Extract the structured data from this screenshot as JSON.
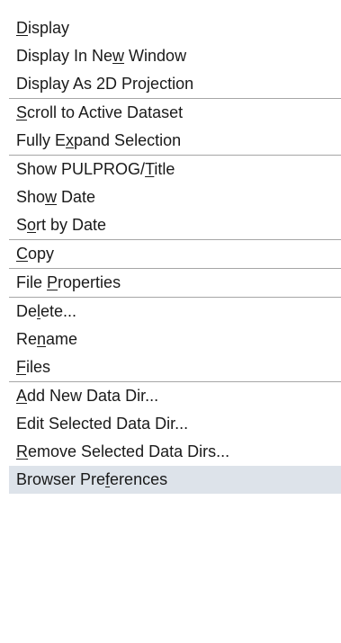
{
  "menu": {
    "groups": [
      {
        "items": [
          {
            "id": "display",
            "pre": "",
            "key": "D",
            "post": "isplay"
          },
          {
            "id": "display-in-new-window",
            "pre": "Display In Ne",
            "key": "w",
            "post": " Window"
          },
          {
            "id": "display-as-2d-projection",
            "pre": "Display As 2D Projection",
            "key": "",
            "post": ""
          }
        ]
      },
      {
        "items": [
          {
            "id": "scroll-to-active-dataset",
            "pre": "",
            "key": "S",
            "post": "croll to Active Dataset"
          },
          {
            "id": "fully-expand-selection",
            "pre": "Fully E",
            "key": "x",
            "post": "pand Selection"
          }
        ]
      },
      {
        "items": [
          {
            "id": "show-pulprog-title",
            "pre": "Show PULPROG/",
            "key": "T",
            "post": "itle"
          },
          {
            "id": "show-date",
            "pre": "Sho",
            "key": "w",
            "post": " Date"
          },
          {
            "id": "sort-by-date",
            "pre": "S",
            "key": "o",
            "post": "rt by Date"
          }
        ]
      },
      {
        "items": [
          {
            "id": "copy",
            "pre": "",
            "key": "C",
            "post": "opy"
          }
        ]
      },
      {
        "items": [
          {
            "id": "file-properties",
            "pre": "File ",
            "key": "P",
            "post": "roperties"
          }
        ]
      },
      {
        "items": [
          {
            "id": "delete",
            "pre": "De",
            "key": "l",
            "post": "ete..."
          },
          {
            "id": "rename",
            "pre": "Re",
            "key": "n",
            "post": "ame"
          },
          {
            "id": "files",
            "pre": "",
            "key": "F",
            "post": "iles"
          }
        ]
      },
      {
        "items": [
          {
            "id": "add-new-data-dir",
            "pre": "",
            "key": "A",
            "post": "dd New Data Dir..."
          },
          {
            "id": "edit-selected-data-dir",
            "pre": "Edit Selected Data Dir...",
            "key": "",
            "post": ""
          },
          {
            "id": "remove-selected-data-dirs",
            "pre": "",
            "key": "R",
            "post": "emove Selected Data Dirs..."
          },
          {
            "id": "browser-preferences",
            "pre": "Browser Pre",
            "key": "f",
            "post": "erences",
            "highlighted": true
          }
        ]
      }
    ],
    "colors": {
      "text": "#1a1a1a",
      "separator": "#a6a6a6",
      "highlight": "#dde3ea",
      "background": "#ffffff"
    }
  }
}
